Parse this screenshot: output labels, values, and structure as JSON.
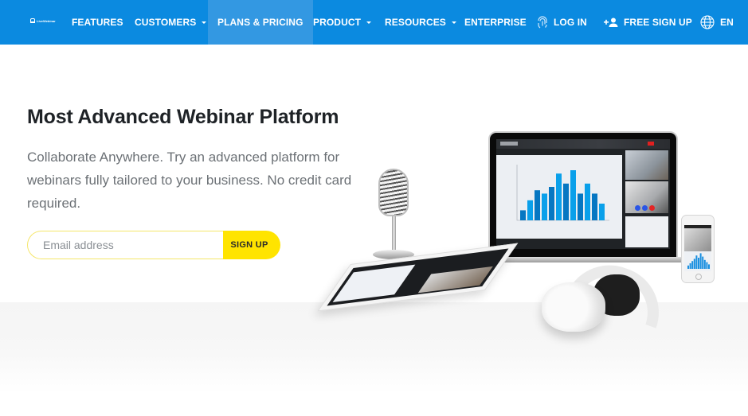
{
  "nav": {
    "logo_text": "LiveWebinar",
    "items": [
      {
        "label": "FEATURES",
        "has_dropdown": false,
        "active": false
      },
      {
        "label": "CUSTOMERS",
        "has_dropdown": true,
        "active": false
      },
      {
        "label": "PLANS & PRICING",
        "has_dropdown": false,
        "active": true
      },
      {
        "label": "PRODUCT",
        "has_dropdown": true,
        "active": false
      },
      {
        "label": "RESOURCES",
        "has_dropdown": true,
        "active": false
      },
      {
        "label": "ENTERPRISE",
        "has_dropdown": false,
        "active": false
      }
    ],
    "login": {
      "label": "LOG IN",
      "icon": "fingerprint-icon"
    },
    "signup": {
      "label": "FREE SIGN UP",
      "icon": "add-user-icon"
    },
    "language": {
      "label": "EN",
      "icon": "globe-icon"
    }
  },
  "hero": {
    "title": "Most Advanced Webinar Platform",
    "subtitle": "Collaborate Anywhere. Try an advanced platform for webinars fully tailored to your business. No credit card required.",
    "email_placeholder": "Email address",
    "email_value": "",
    "signup_button": "SIGN UP"
  },
  "colors": {
    "nav_bg": "#0b8ae0",
    "nav_active_bg": "#3398e2",
    "cta_yellow": "#ffe400",
    "title_text": "#1e2226",
    "subtitle_text": "#6c7176"
  },
  "illustration": {
    "description": "Devices: microphone, laptop showing webinar room with bar chart, tablet, phone, headphones"
  }
}
